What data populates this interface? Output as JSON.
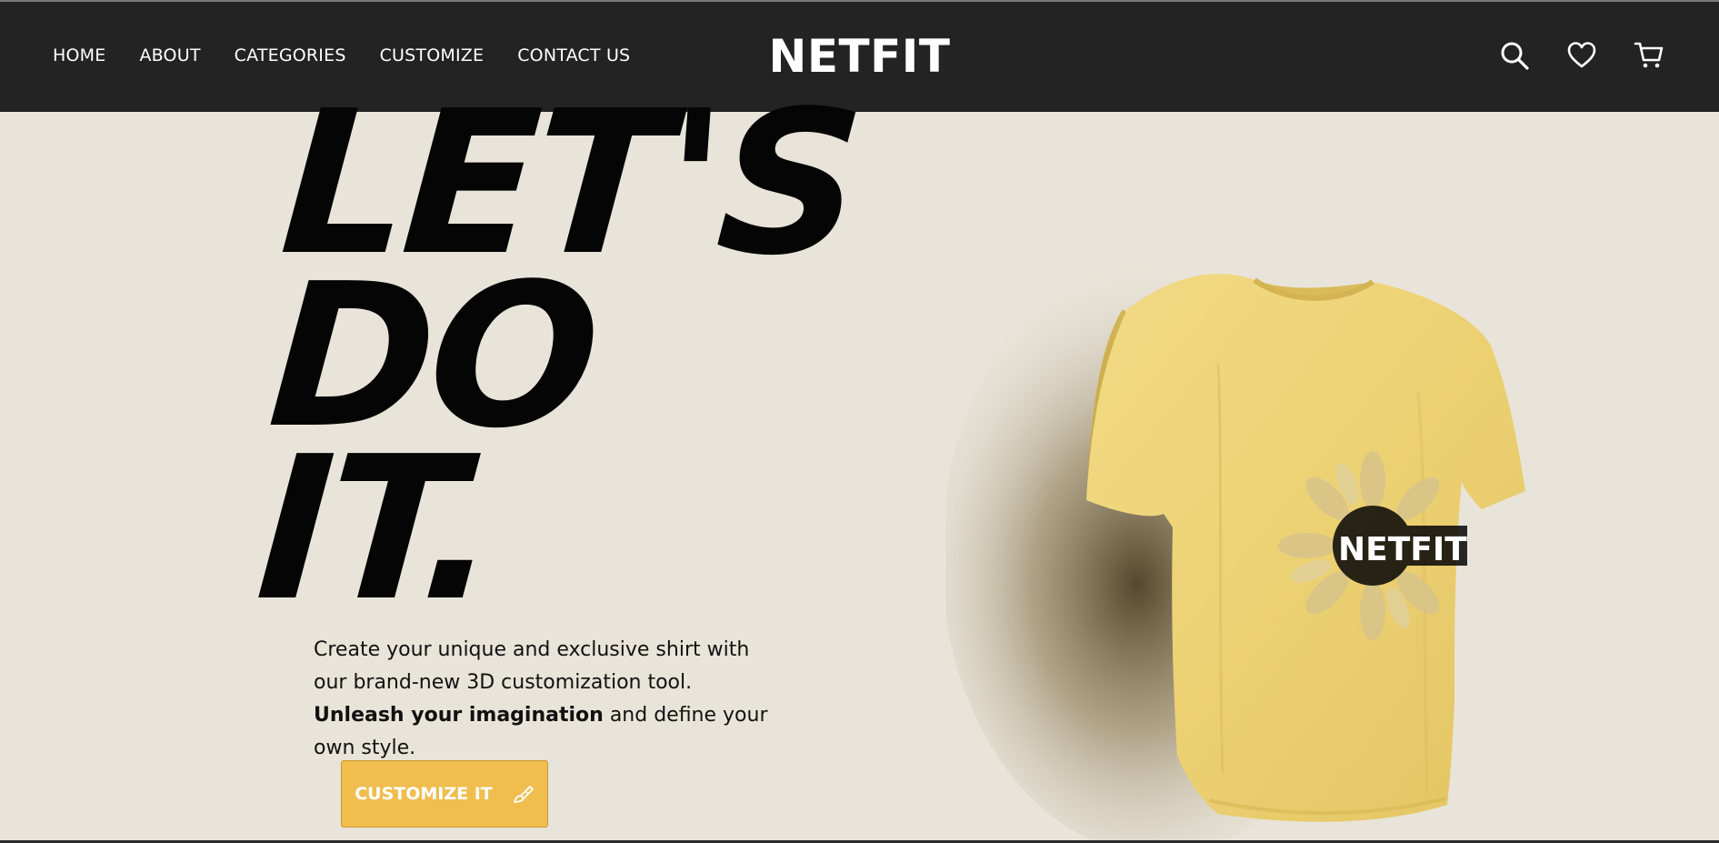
{
  "nav": {
    "items": [
      "HOME",
      "ABOUT",
      "CATEGORIES",
      "CUSTOMIZE",
      "CONTACT US"
    ]
  },
  "brand": {
    "logo": "NETFIT",
    "shirt_print": "NETFIT"
  },
  "icons": {
    "search": "search-icon",
    "wishlist": "heart-icon",
    "cart": "cart-icon"
  },
  "hero": {
    "title_lines": [
      "LET'S",
      "DO",
      "IT."
    ],
    "text_part1": "Create your unique and exclusive shirt with our brand-new 3D customization tool. ",
    "text_bold": "Unleash your imagination",
    "text_part2": " and define your own style.",
    "cta_label": "CUSTOMIZE IT",
    "cta_icon": "paintbrush-icon"
  },
  "colors": {
    "header_bg": "#232323",
    "page_bg": "#e9e4d9",
    "accent": "#f0bd4f",
    "shirt": "#ecd173"
  }
}
